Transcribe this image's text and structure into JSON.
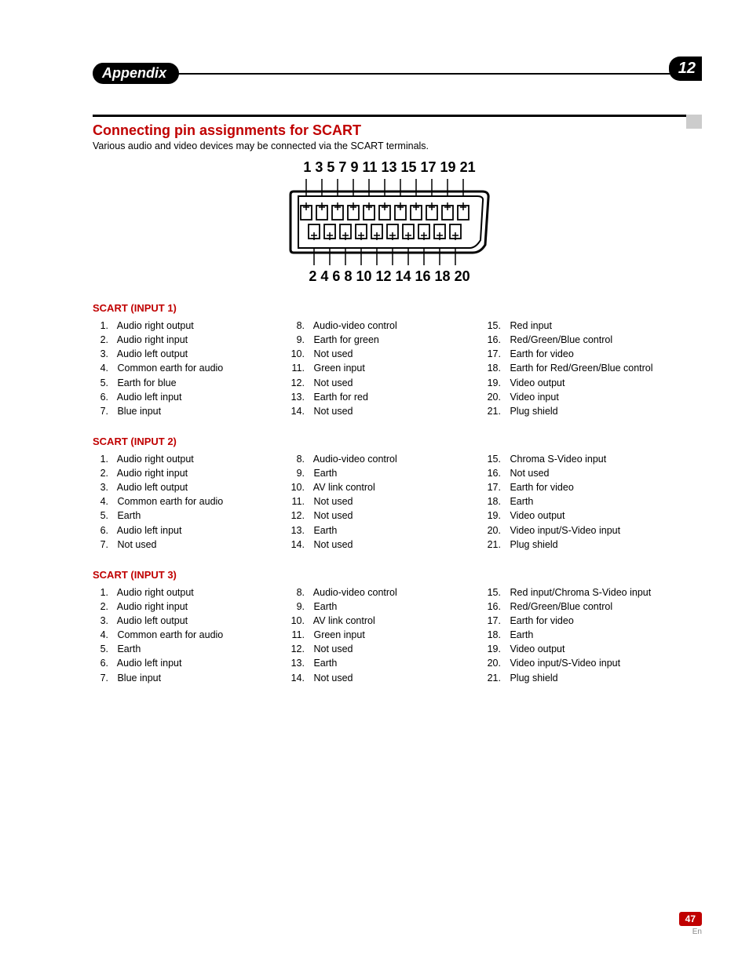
{
  "header": {
    "appendix": "Appendix",
    "chapter": "12"
  },
  "section_title": "Connecting pin assignments for SCART",
  "intro": "Various audio and video devices may be connected via the SCART terminals.",
  "diagram": {
    "top_numbers": "1  3  5  7  9 11 13 15 17 19 21",
    "bottom_numbers": "2  4  6  8 10 12 14 16 18 20"
  },
  "scart1": {
    "title": "SCART (INPUT 1)",
    "pins": [
      {
        "n": "1",
        "t": "Audio right output"
      },
      {
        "n": "2",
        "t": "Audio right input"
      },
      {
        "n": "3",
        "t": "Audio left output"
      },
      {
        "n": "4",
        "t": "Common earth for audio"
      },
      {
        "n": "5",
        "t": "Earth for blue"
      },
      {
        "n": "6",
        "t": "Audio left input"
      },
      {
        "n": "7",
        "t": "Blue input"
      },
      {
        "n": "8",
        "t": "Audio-video control"
      },
      {
        "n": "9",
        "t": "Earth for green"
      },
      {
        "n": "10",
        "t": "Not used"
      },
      {
        "n": "11",
        "t": "Green input"
      },
      {
        "n": "12",
        "t": "Not used"
      },
      {
        "n": "13",
        "t": "Earth for red"
      },
      {
        "n": "14",
        "t": "Not used"
      },
      {
        "n": "15",
        "t": "Red input"
      },
      {
        "n": "16",
        "t": "Red/Green/Blue control"
      },
      {
        "n": "17",
        "t": "Earth for video"
      },
      {
        "n": "18",
        "t": "Earth for Red/Green/Blue control"
      },
      {
        "n": "19",
        "t": "Video output"
      },
      {
        "n": "20",
        "t": "Video input"
      },
      {
        "n": "21",
        "t": "Plug shield"
      }
    ]
  },
  "scart2": {
    "title": "SCART (INPUT 2)",
    "pins": [
      {
        "n": "1",
        "t": "Audio right output"
      },
      {
        "n": "2",
        "t": "Audio right input"
      },
      {
        "n": "3",
        "t": "Audio left output"
      },
      {
        "n": "4",
        "t": "Common earth for audio"
      },
      {
        "n": "5",
        "t": "Earth"
      },
      {
        "n": "6",
        "t": "Audio left input"
      },
      {
        "n": "7",
        "t": "Not used"
      },
      {
        "n": "8",
        "t": "Audio-video control"
      },
      {
        "n": "9",
        "t": "Earth"
      },
      {
        "n": "10",
        "t": "AV link control"
      },
      {
        "n": "11",
        "t": "Not used"
      },
      {
        "n": "12",
        "t": "Not used"
      },
      {
        "n": "13",
        "t": "Earth"
      },
      {
        "n": "14",
        "t": "Not used"
      },
      {
        "n": "15",
        "t": "Chroma S-Video input"
      },
      {
        "n": "16",
        "t": "Not used"
      },
      {
        "n": "17",
        "t": "Earth for video"
      },
      {
        "n": "18",
        "t": "Earth"
      },
      {
        "n": "19",
        "t": "Video output"
      },
      {
        "n": "20",
        "t": "Video input/S-Video input"
      },
      {
        "n": "21",
        "t": "Plug shield"
      }
    ]
  },
  "scart3": {
    "title": "SCART (INPUT 3)",
    "pins": [
      {
        "n": "1",
        "t": "Audio right output"
      },
      {
        "n": "2",
        "t": "Audio right input"
      },
      {
        "n": "3",
        "t": "Audio left output"
      },
      {
        "n": "4",
        "t": "Common earth for audio"
      },
      {
        "n": "5",
        "t": "Earth"
      },
      {
        "n": "6",
        "t": "Audio left input"
      },
      {
        "n": "7",
        "t": "Blue input"
      },
      {
        "n": "8",
        "t": "Audio-video control"
      },
      {
        "n": "9",
        "t": "Earth"
      },
      {
        "n": "10",
        "t": "AV link control"
      },
      {
        "n": "11",
        "t": "Green input"
      },
      {
        "n": "12",
        "t": " Not used"
      },
      {
        "n": "13",
        "t": "Earth"
      },
      {
        "n": "14",
        "t": "Not used"
      },
      {
        "n": "15",
        "t": "Red input/Chroma S-Video input"
      },
      {
        "n": "16",
        "t": "Red/Green/Blue control"
      },
      {
        "n": "17",
        "t": "Earth for video"
      },
      {
        "n": "18",
        "t": "Earth"
      },
      {
        "n": "19",
        "t": "Video output"
      },
      {
        "n": "20",
        "t": "Video input/S-Video input"
      },
      {
        "n": "21",
        "t": " Plug shield"
      }
    ]
  },
  "footer": {
    "page": "47",
    "lang": "En"
  }
}
